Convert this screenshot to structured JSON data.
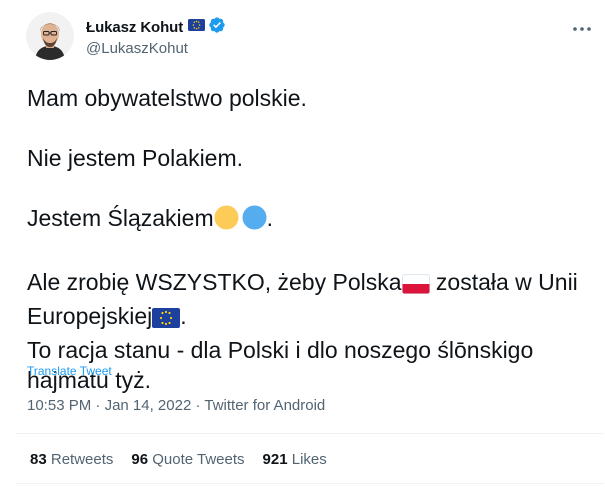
{
  "author": {
    "name": "Łukasz Kohut",
    "handle": "@LukaszKohut",
    "verified": true
  },
  "tweet": {
    "line1": "Mam obywatelstwo polskie.",
    "line2": "Nie jestem Polakiem.",
    "line3_text": "Jestem Ślązakiem",
    "line3_end": ".",
    "line4_a": "Ale zrobię WSZYSTKO, żeby Polska",
    "line4_b": " została w Unii",
    "line5_a": "Europejskiej",
    "line5_b": ".",
    "line6": "To racja stanu - dla Polski i dlo noszego ślōnskigo",
    "line7": "hajmatu tyż."
  },
  "translate_label": "Translate Tweet",
  "meta": {
    "time": "10:53 PM",
    "sep1": " · ",
    "date": "Jan 14, 2022",
    "sep2": " · ",
    "source": "Twitter for Android"
  },
  "stats": {
    "retweets_count": "83",
    "retweets_label": "Retweets",
    "quotes_count": "96",
    "quotes_label": "Quote Tweets",
    "likes_count": "921",
    "likes_label": "Likes"
  },
  "colors": {
    "text": "#0f1419",
    "secondary": "#536471",
    "link": "#1d9bf0",
    "divider": "#eff3f4",
    "eu_blue": "#1d3f9e",
    "eu_star": "#ffd400",
    "silesia_yellow": "#fdcb58",
    "silesia_blue": "#55acee",
    "poland_red": "#dc143c"
  },
  "icons": {
    "avatar": "profile-photo",
    "author_flag": "eu-flag-icon",
    "verified": "verified-badge-icon",
    "more": "more-dots-icon",
    "emoji_yellow": "yellow-circle-icon",
    "emoji_blue": "blue-circle-icon",
    "emoji_poland": "poland-flag-icon",
    "emoji_eu": "eu-flag-icon"
  }
}
